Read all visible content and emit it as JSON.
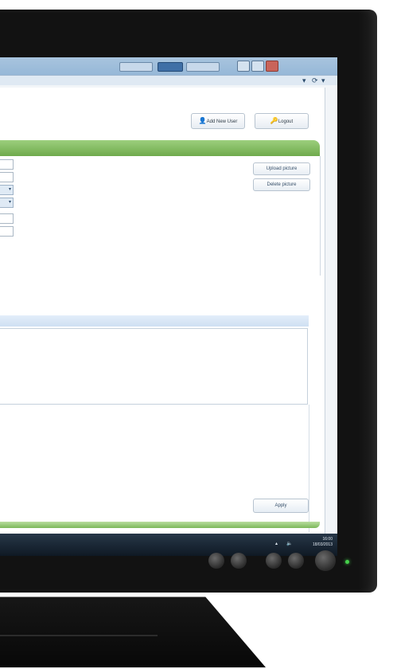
{
  "browser": {
    "tabs": [
      "",
      "",
      ""
    ],
    "address_icons": [
      "▾",
      "⟳",
      "▾"
    ]
  },
  "header": {
    "add_button_label": "Add New User",
    "logout_button_label": "Logout"
  },
  "form": {
    "side_buttons": [
      "Upload picture",
      "Delete picture"
    ]
  },
  "footer": {
    "apply_label": "Apply"
  },
  "taskbar": {
    "time": "16:00",
    "date": "18/03/2013"
  },
  "colors": {
    "accent_green": "#7cb85a",
    "titlebar_blue": "#8cb1d4",
    "led": "#45d14b"
  }
}
